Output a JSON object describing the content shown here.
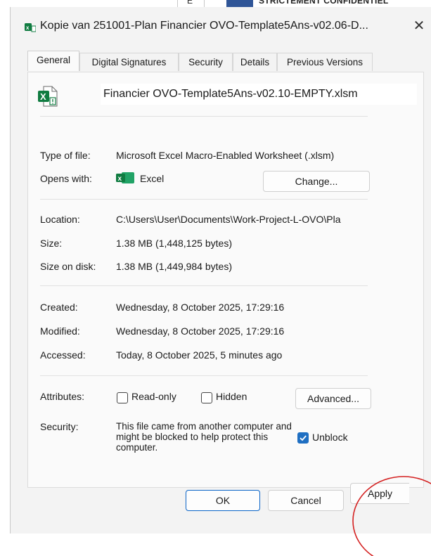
{
  "background": {
    "cell_e": "E",
    "banner_text": "STRICTEMENT CONFIDENTIEL"
  },
  "window": {
    "title": "Kopie van 251001-Plan Financier OVO-Template5Ans-v02.06-D...",
    "close_symbol": "✕"
  },
  "tabs": [
    {
      "label": "General"
    },
    {
      "label": "Digital Signatures"
    },
    {
      "label": "Security"
    },
    {
      "label": "Details"
    },
    {
      "label": "Previous Versions"
    }
  ],
  "general": {
    "filename": "Financier OVO-Template5Ans-v02.10-EMPTY.xlsm",
    "type_label": "Type of file:",
    "type_value": "Microsoft Excel Macro-Enabled Worksheet (.xlsm)",
    "opens_label": "Opens with:",
    "opens_value": "Excel",
    "change_button": "Change...",
    "location_label": "Location:",
    "location_value": "C:\\Users\\User\\Documents\\Work-Project-L-OVO\\Pla",
    "size_label": "Size:",
    "size_value": "1.38 MB (1,448,125 bytes)",
    "size_disk_label": "Size on disk:",
    "size_disk_value": "1.38 MB (1,449,984 bytes)",
    "created_label": "Created:",
    "created_value": "Wednesday, 8 October 2025, 17:29:16",
    "modified_label": "Modified:",
    "modified_value": "Wednesday, 8 October 2025, 17:29:16",
    "accessed_label": "Accessed:",
    "accessed_value": "Today, 8 October 2025, 5 minutes ago",
    "attributes_label": "Attributes:",
    "readonly_label": "Read-only",
    "readonly_checked": false,
    "hidden_label": "Hidden",
    "hidden_checked": false,
    "advanced_button": "Advanced...",
    "security_label": "Security:",
    "security_text": "This file came from another computer and might be blocked to help protect this computer.",
    "unblock_label": "Unblock",
    "unblock_checked": true
  },
  "footer": {
    "ok": "OK",
    "cancel": "Cancel",
    "apply": "Apply"
  },
  "colors": {
    "accent": "#1f6fc2",
    "excel_green": "#107c41",
    "annotation_red": "#d42020"
  },
  "icons": {
    "title": "excel-file-icon",
    "file": "excel-file-icon",
    "opens_with": "excel-app-icon",
    "close": "close-icon",
    "check": "checkmark-icon"
  }
}
